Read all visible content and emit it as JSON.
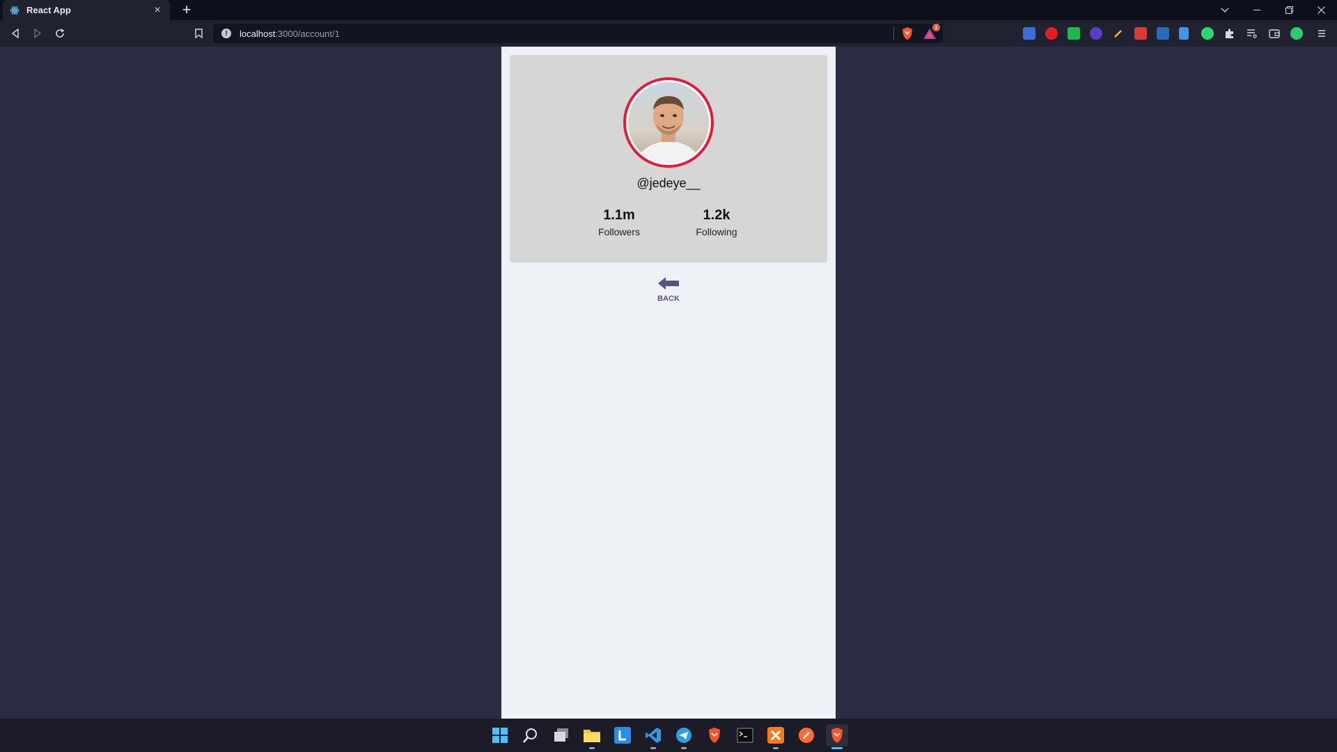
{
  "browser": {
    "tab_title": "React App",
    "url_host": "localhost",
    "url_path": ":3000/account/1",
    "rewards_badge": "1"
  },
  "profile": {
    "username": "@jedeye__",
    "stats": [
      {
        "value": "1.1m",
        "label": "Followers"
      },
      {
        "value": "1.2k",
        "label": "Following"
      }
    ],
    "back_label": "BACK"
  },
  "colors": {
    "page_bg": "#2b2d42",
    "avatar_ring": "#e01c3c",
    "back_accent": "#5a5380"
  },
  "taskbar": {
    "icons": [
      "windows-start-icon",
      "search-icon",
      "task-view-icon",
      "file-explorer-icon",
      "l-app-icon",
      "vscode-icon",
      "telegram-icon",
      "brave-icon",
      "terminal-icon",
      "xampp-icon",
      "postman-icon",
      "brave-active-icon"
    ]
  }
}
